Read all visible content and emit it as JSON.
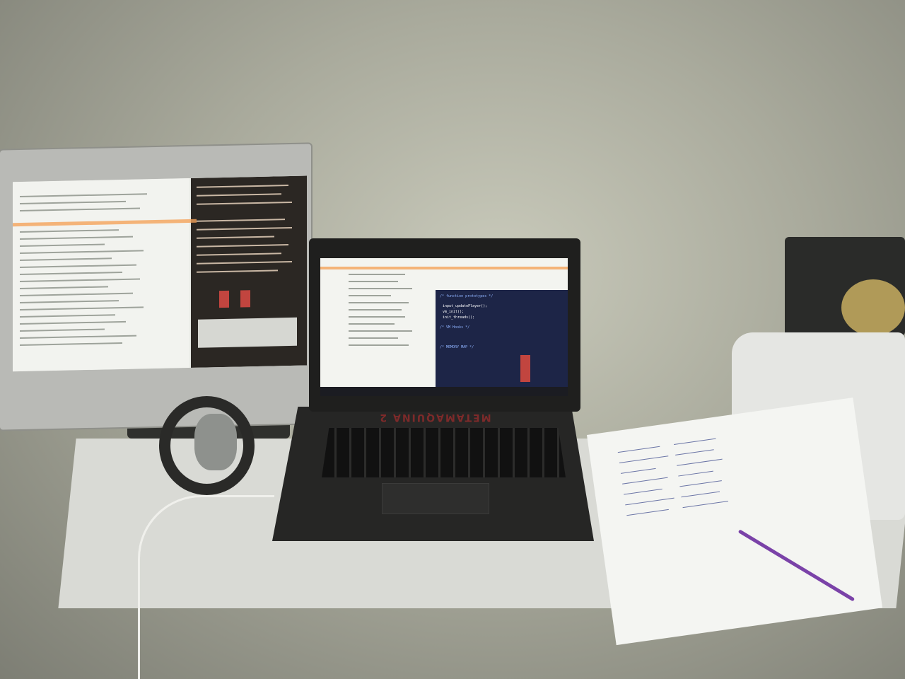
{
  "scene": {
    "description_items": [
      "external-monitor",
      "laptop",
      "desk",
      "printer",
      "notebook",
      "headphones"
    ]
  },
  "laptop": {
    "brand_text": "METAMAQUINA 2",
    "terminal_lines": [
      "/* function prototypes */",
      "input_updatePlayer();",
      "vm_init();",
      "init_threads();",
      "/* VM Hooks */",
      "/* MEMORY MAP */"
    ]
  },
  "colors": {
    "highlight": "#f4a35a",
    "terminal_bg": "#1d2547",
    "pen": "#7a42a8"
  }
}
